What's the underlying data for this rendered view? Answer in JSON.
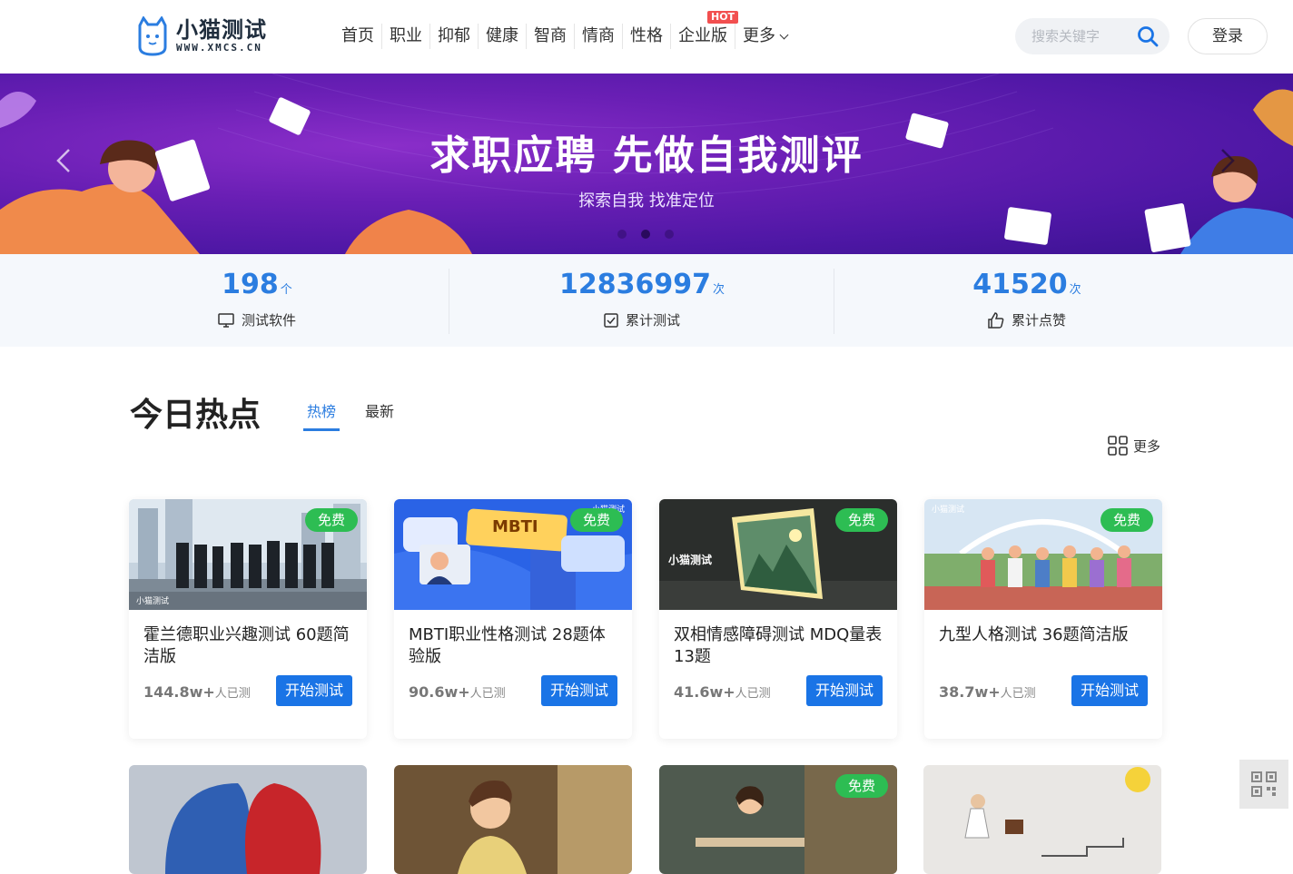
{
  "logo": {
    "main": "小猫测试",
    "sub": "WWW.XMCS.CN"
  },
  "nav": {
    "items": [
      "首页",
      "职业",
      "抑郁",
      "健康",
      "智商",
      "情商",
      "性格",
      "企业版"
    ],
    "more": "更多",
    "hot_badge": "HOT"
  },
  "search": {
    "placeholder": "搜索关键字"
  },
  "login": "登录",
  "banner": {
    "title": "求职应聘  先做自我测评",
    "subtitle": "探索自我 找准定位"
  },
  "stats": [
    {
      "value": "198",
      "unit": "个",
      "label": "测试软件",
      "icon": "monitor-icon"
    },
    {
      "value": "12836997",
      "unit": "次",
      "label": "累计测试",
      "icon": "checkbox-icon"
    },
    {
      "value": "41520",
      "unit": "次",
      "label": "累计点赞",
      "icon": "thumbs-up-icon"
    }
  ],
  "hot": {
    "title": "今日热点",
    "tabs": [
      "热榜",
      "最新"
    ],
    "more": "更多"
  },
  "cards": [
    {
      "title": "霍兰德职业兴趣测试 60题简洁版",
      "count": "144.8w+",
      "count_suffix": "人已测",
      "badge": "免费",
      "button": "开始测试",
      "watermark": "小猫测试"
    },
    {
      "title": "MBTI职业性格测试 28题体验版",
      "count": "90.6w+",
      "count_suffix": "人已测",
      "badge": "免费",
      "button": "开始测试",
      "art_label": "MBTI",
      "watermark": "小猫测试"
    },
    {
      "title": "双相情感障碍测试 MDQ量表13题",
      "count": "41.6w+",
      "count_suffix": "人已测",
      "badge": "免费",
      "button": "开始测试",
      "watermark": "小猫测试"
    },
    {
      "title": "九型人格测试 36题简洁版",
      "count": "38.7w+",
      "count_suffix": "人已测",
      "badge": "免费",
      "button": "开始测试",
      "watermark": "小猫测试"
    }
  ],
  "second_row": {
    "badge": "免费"
  },
  "colors": {
    "accent": "#2b7de0",
    "button": "#1a74e6",
    "free": "#2dbd53",
    "hot": "#f24f4f",
    "banner": "#6a1fb5"
  }
}
